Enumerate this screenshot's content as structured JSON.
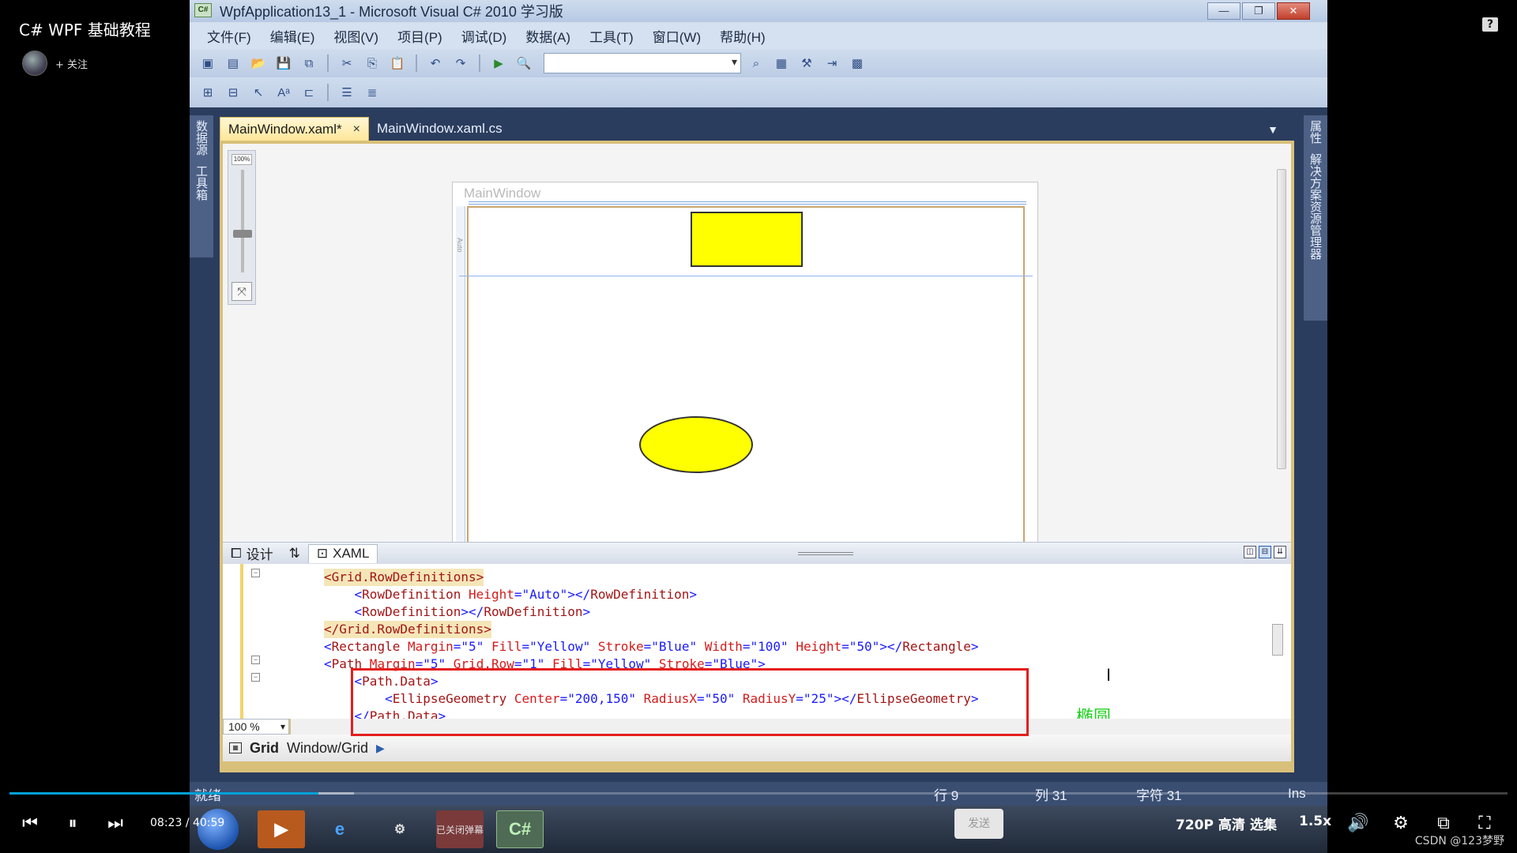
{
  "player": {
    "video_title": "C# WPF 基础教程",
    "follow_label": "+ 关注",
    "help_icon": "?",
    "current_time": "08:23",
    "time_separator": "/",
    "total_time": "40:59",
    "progress_fraction": 0.206,
    "buffered_fraction": 0.23,
    "send_label": "发送",
    "quality_label": "720P 高清",
    "episodes_label": "选集",
    "speed_label": "1.5x",
    "watermark": "CSDN @123梦野",
    "accent_color": "#00a1d6"
  },
  "vs": {
    "window_title": "WpfApplication13_1 - Microsoft Visual C# 2010 学习版",
    "app_icon_text": "C#",
    "window_buttons": [
      "—",
      "❐",
      "✕"
    ],
    "menu": [
      "文件(F)",
      "编辑(E)",
      "视图(V)",
      "项目(P)",
      "调试(D)",
      "数据(A)",
      "工具(T)",
      "窗口(W)",
      "帮助(H)"
    ],
    "left_strip_tabs": [
      "数据源",
      "工具箱"
    ],
    "right_strip_tabs": [
      "属性",
      "解决方案资源管理器"
    ],
    "tabs": [
      {
        "label": "MainWindow.xaml*",
        "active": true
      },
      {
        "label": "MainWindow.xaml.cs",
        "active": false
      }
    ],
    "tab_close": "×",
    "designer": {
      "zoom_slider_label": "100%",
      "window_caption": "MainWindow",
      "row_auto_label": "Auto",
      "shape_fill": "#ffff00",
      "shape_stroke": "#333333"
    },
    "split_tabs": {
      "design": "设计",
      "swap": "⇅",
      "xaml": "XAML"
    },
    "code_lines": [
      {
        "indent": "",
        "parts": [
          [
            "tag",
            "<Grid.RowDefinitions>"
          ]
        ],
        "highlight": true
      },
      {
        "indent": "    ",
        "parts": [
          [
            "br",
            "<"
          ],
          [
            "tag",
            "RowDefinition"
          ],
          [
            "attr",
            " Height"
          ],
          [
            "br",
            "="
          ],
          [
            "val",
            "\"Auto\""
          ],
          [
            "br",
            "></"
          ],
          [
            "tag",
            "RowDefinition"
          ],
          [
            "br",
            ">"
          ]
        ],
        "highlight": false
      },
      {
        "indent": "    ",
        "parts": [
          [
            "br",
            "<"
          ],
          [
            "tag",
            "RowDefinition"
          ],
          [
            "br",
            "></"
          ],
          [
            "tag",
            "RowDefinition"
          ],
          [
            "br",
            ">"
          ]
        ],
        "highlight": false
      },
      {
        "indent": "",
        "parts": [
          [
            "tag",
            "</Grid.RowDefinitions>"
          ]
        ],
        "highlight": true
      },
      {
        "indent": "",
        "parts": [
          [
            "br",
            "<"
          ],
          [
            "tag",
            "Rectangle"
          ],
          [
            "attr",
            " Margin"
          ],
          [
            "br",
            "="
          ],
          [
            "val",
            "\"5\""
          ],
          [
            "attr",
            " Fill"
          ],
          [
            "br",
            "="
          ],
          [
            "val",
            "\"Yellow\""
          ],
          [
            "attr",
            " Stroke"
          ],
          [
            "br",
            "="
          ],
          [
            "val",
            "\"Blue\""
          ],
          [
            "attr",
            " Width"
          ],
          [
            "br",
            "="
          ],
          [
            "val",
            "\"100\""
          ],
          [
            "attr",
            " Height"
          ],
          [
            "br",
            "="
          ],
          [
            "val",
            "\"50\""
          ],
          [
            "br",
            "></"
          ],
          [
            "tag",
            "Rectangle"
          ],
          [
            "br",
            ">"
          ]
        ],
        "highlight": false
      },
      {
        "indent": "",
        "parts": [
          [
            "br",
            "<"
          ],
          [
            "tag",
            "Path"
          ],
          [
            "attr",
            " Margin"
          ],
          [
            "br",
            "="
          ],
          [
            "val",
            "\"5\""
          ],
          [
            "attr",
            " Grid.Row"
          ],
          [
            "br",
            "="
          ],
          [
            "val",
            "\"1\""
          ],
          [
            "attr",
            " Fill"
          ],
          [
            "br",
            "="
          ],
          [
            "val",
            "\"Yellow\""
          ],
          [
            "attr",
            " Stroke"
          ],
          [
            "br",
            "="
          ],
          [
            "val",
            "\"Blue\""
          ],
          [
            "br",
            ">"
          ]
        ],
        "highlight": false
      },
      {
        "indent": "    ",
        "parts": [
          [
            "br",
            "<"
          ],
          [
            "tag",
            "Path.Data"
          ],
          [
            "br",
            ">"
          ]
        ],
        "highlight": false
      },
      {
        "indent": "        ",
        "parts": [
          [
            "br",
            "<"
          ],
          [
            "tag",
            "EllipseGeometry"
          ],
          [
            "attr",
            " Center"
          ],
          [
            "br",
            "="
          ],
          [
            "val",
            "\"200,150\""
          ],
          [
            "attr",
            " RadiusX"
          ],
          [
            "br",
            "="
          ],
          [
            "val",
            "\"50\""
          ],
          [
            "attr",
            " RadiusY"
          ],
          [
            "br",
            "="
          ],
          [
            "val",
            "\"25\""
          ],
          [
            "br",
            "></"
          ],
          [
            "tag",
            "EllipseGeometry"
          ],
          [
            "br",
            ">"
          ]
        ],
        "highlight": false
      },
      {
        "indent": "    ",
        "parts": [
          [
            "br",
            "</"
          ],
          [
            "tag",
            "Path.Data"
          ],
          [
            "br",
            ">"
          ]
        ],
        "highlight": false
      }
    ],
    "annotation_label": "椭圆",
    "annotation_color": "#e41e1e",
    "annotation_text_color": "#1fd11f",
    "zoom_combo": "100 %",
    "breadcrumb": {
      "element": "Grid",
      "path": "Window/Grid"
    },
    "status": {
      "ready": "就绪",
      "row": "行 9",
      "col": "列 31",
      "char": "字符 31",
      "ins": "Ins"
    },
    "taskbar_active_app": "C#",
    "taskbar_label": "已关闭弹幕"
  }
}
